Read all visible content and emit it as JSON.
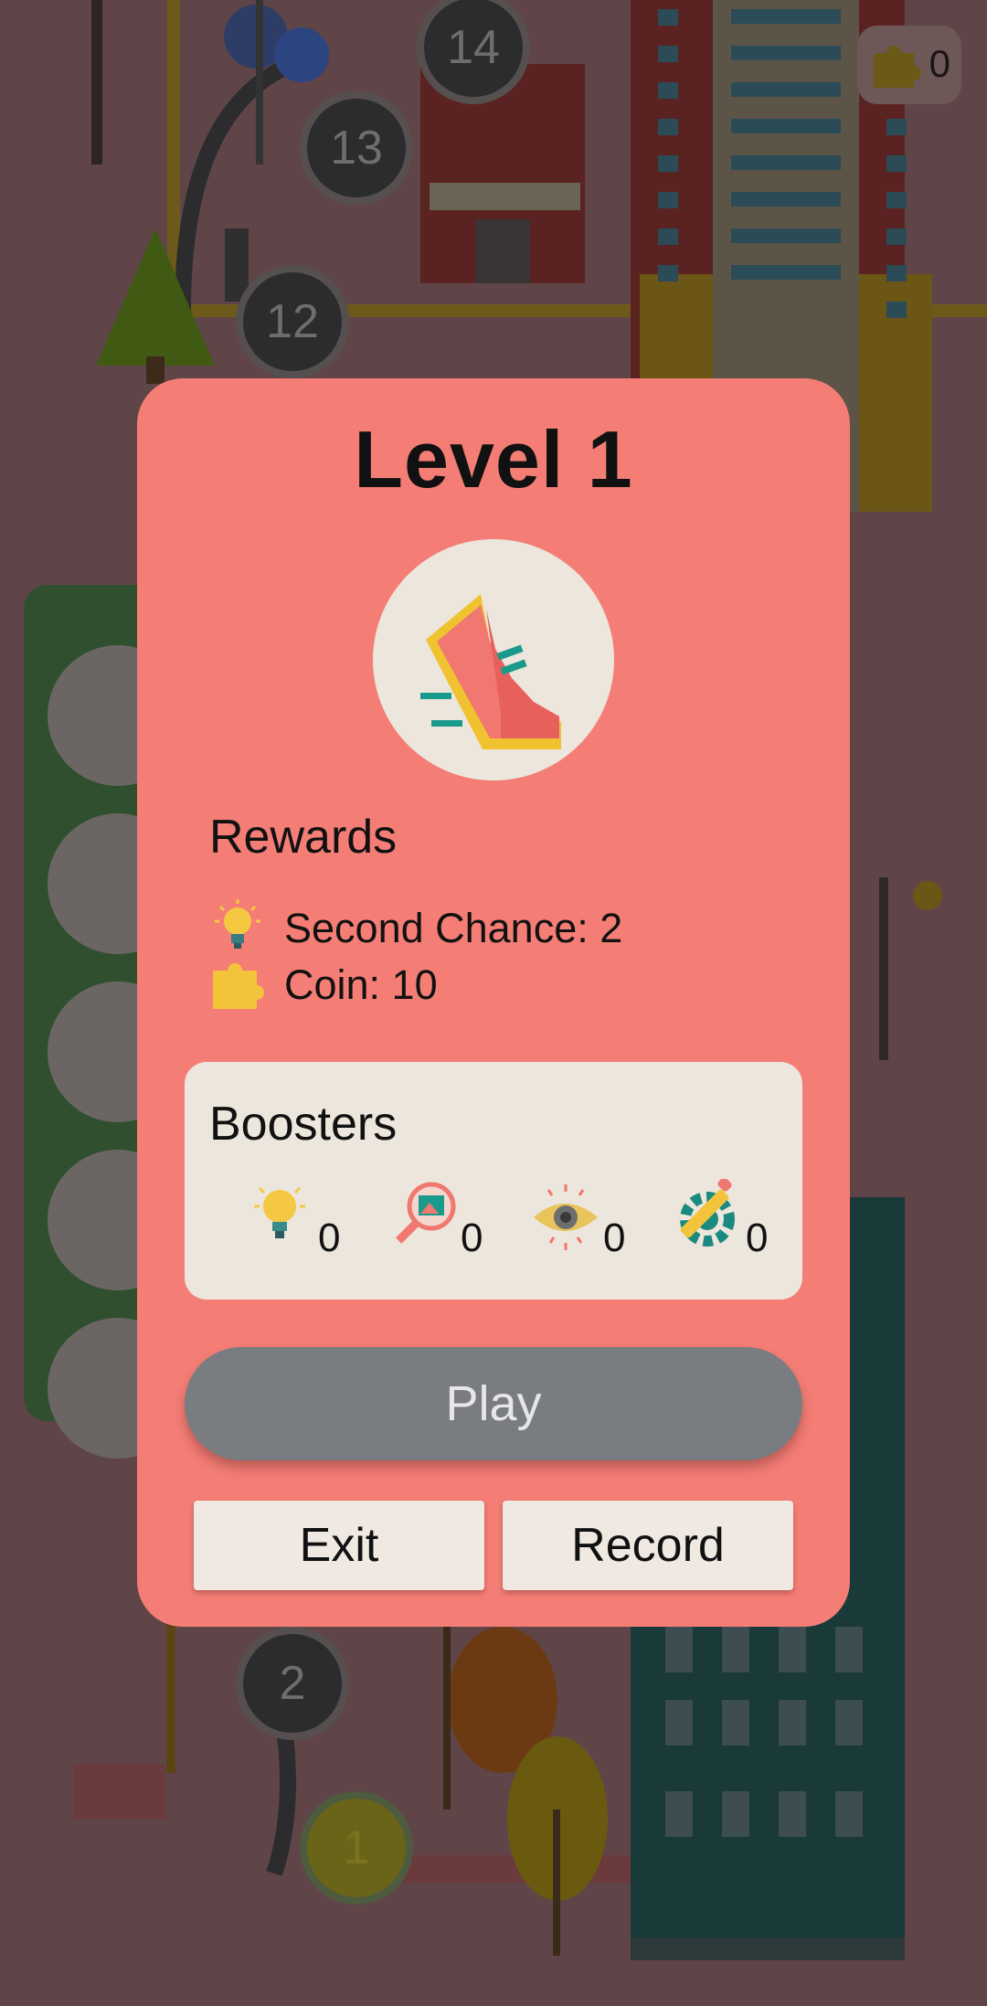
{
  "coins": {
    "count": "0"
  },
  "map": {
    "nodes": [
      {
        "label": "14"
      },
      {
        "label": "13"
      },
      {
        "label": "12"
      },
      {
        "label": "2"
      },
      {
        "label": "1"
      }
    ]
  },
  "dialog": {
    "title": "Level 1",
    "hero_icon": "running-shoe-icon",
    "rewards": {
      "title": "Rewards",
      "items": [
        {
          "icon": "lightbulb-icon",
          "label": "Second Chance: 2"
        },
        {
          "icon": "puzzle-piece-icon",
          "label": "Coin: 10"
        }
      ]
    },
    "boosters": {
      "title": "Boosters",
      "items": [
        {
          "icon": "lightbulb-icon",
          "count": "0"
        },
        {
          "icon": "magnifier-image-icon",
          "count": "0"
        },
        {
          "icon": "eye-icon",
          "count": "0"
        },
        {
          "icon": "gear-pencil-icon",
          "count": "0"
        }
      ]
    },
    "play_label": "Play",
    "exit_label": "Exit",
    "record_label": "Record"
  },
  "colors": {
    "dialog_bg": "#f47e75",
    "panel_bg": "#ece6dd",
    "play_bg": "#797c80",
    "backdrop": "#5f4547"
  }
}
